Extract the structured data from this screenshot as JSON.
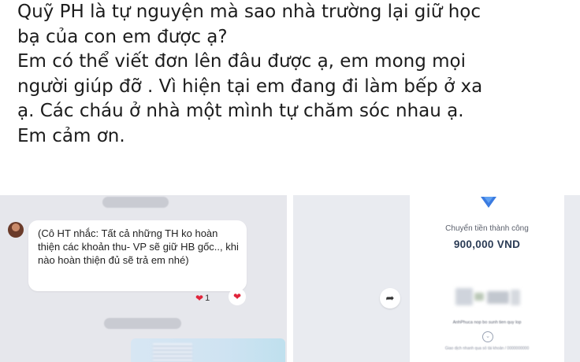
{
  "post": {
    "lines": [
      "Quỹ PH là tự nguyện mà sao nhà trường lại giữ học",
      "bạ của con em được ạ?",
      "Em có thể viết đơn lên đâu được ạ, em mong mọi",
      "người giúp đỡ . Vì hiện tại em đang đi làm bếp ở xa",
      "ạ. Các cháu ở nhà một mình tự chăm sóc nhau ạ.",
      "Em cảm ơn."
    ]
  },
  "chat": {
    "message": "(Cô HT nhắc: Tất cả những TH ko hoàn thiện các khoản thu- VP sẽ giữ HB gốc.., khi nào hoàn thiện đủ sẽ trả em nhé)",
    "reaction_count": "1",
    "icons": {
      "avatar": "avatar",
      "heart": "heart-icon",
      "share": "share-icon"
    }
  },
  "receipt": {
    "status": "Chuyển tiền thành công",
    "amount": "900,000 VND",
    "note": "AnhPhuca nop bo sunh tien quy lop",
    "footer": "Giao dịch nhanh qua số tài khoản / 0000000000"
  },
  "colors": {
    "accent": "#3b7be0",
    "heart": "#e0243a",
    "amount": "#2a3b55"
  }
}
